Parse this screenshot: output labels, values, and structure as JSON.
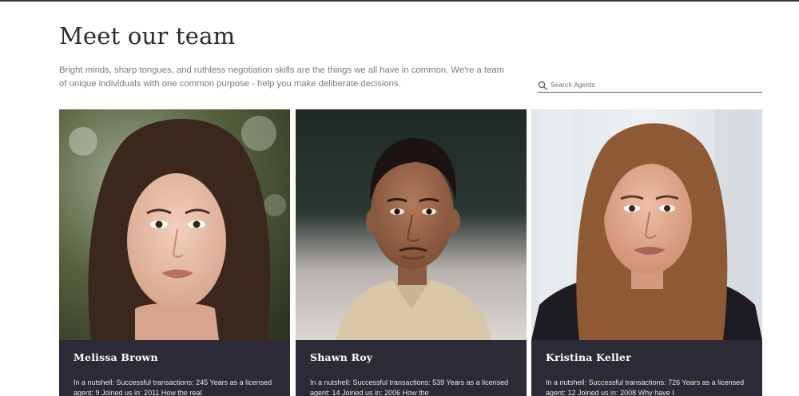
{
  "header": {
    "title": "Meet our team",
    "intro": "Bright minds, sharp tongues, and ruthless negotiation skills are the things we all have in common. We're a team of unique individuals with one common purpose - help you make deliberate decisions."
  },
  "search": {
    "placeholder": "Search Agents",
    "icon": "search-icon"
  },
  "agents": [
    {
      "name": "Melissa Brown",
      "bio": "In a nutshell:  Successful transactions: 245 Years as a licensed agent: 9 Joined us in: 2011 How the real",
      "photo": "portrait-woman-dark-hair"
    },
    {
      "name": "Shawn Roy",
      "bio": "In a nutshell:  Successful transactions: 539 Years as a licensed agent: 14 Joined us in: 2006 How the",
      "photo": "portrait-man-short-hair"
    },
    {
      "name": "Kristina Keller",
      "bio": "In a nutshell:  Successful transactions: 726 Years as a licensed agent: 12 Joined us in: 2008  Why have I",
      "photo": "portrait-woman-brown-hair"
    }
  ],
  "colors": {
    "title": "#2b2b33",
    "card_panel": "#2b2a36",
    "intro_text": "#7a7a80"
  }
}
